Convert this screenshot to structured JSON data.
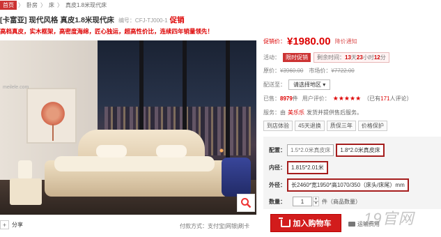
{
  "breadcrumb": [
    "首页",
    "卧房",
    "床",
    "真皮1.8米现代床"
  ],
  "breadcrumb_sep": "〉",
  "title": {
    "name": "[卡富亚] 现代风格 真皮1.8米现代床",
    "code": "编号：CFJ-TJ000-1",
    "hot": "促销"
  },
  "slogan": "高档真皮，实木框架，高密度海绵，匠心独运，超高性价比，连续四年销量领先！",
  "image": {
    "watermark": "meilele.com",
    "zoom_icon": "magnifier-icon"
  },
  "share": {
    "plus": "+",
    "label": "分享"
  },
  "payment": "付款方式：支付宝|网银|刷卡",
  "price": {
    "label": "促销价：",
    "value": "¥1980.00",
    "notify": "降价通知"
  },
  "promo": {
    "label": "活动：",
    "tag": "限时促销",
    "prefix": "剩余时间：",
    "days": "13",
    "days_unit": "天",
    "hours": "23",
    "hours_unit": "小时",
    "minutes": "12",
    "minutes_unit": "分"
  },
  "original": {
    "label": "原价：",
    "value": "¥3960.00",
    "market_label": "市场价：",
    "market_value": "¥7722.00"
  },
  "shipping": {
    "label": "配送至：",
    "select": "请选择地区",
    "arrow": "▾"
  },
  "sales": {
    "label": "已售：",
    "count": "8979",
    "unit": "件",
    "review_label": "用户评价：",
    "stars": "★★★★★",
    "review_pre": "（已有",
    "review_count": "171",
    "review_post": "人评论）"
  },
  "service": {
    "label": "服务：",
    "pre": "由",
    "store": "美乐乐",
    "post": "发货并提供售后服务。"
  },
  "tags": [
    "到店体验",
    "45天退换",
    "质保三年",
    "价格保护"
  ],
  "options": {
    "spec": {
      "label": "配置：",
      "values": [
        "1.5*2.0米真皮床",
        "1.8*2.0米真皮床"
      ]
    },
    "inner": {
      "label": "内径：",
      "value": "1.815*2.01米"
    },
    "outer": {
      "label": "外径：",
      "value": "长2460*宽1950*高1070/350（床头/床尾）mm"
    }
  },
  "quantity": {
    "label": "数量：",
    "value": "1",
    "unit": "件（商品数量）"
  },
  "cart_button": "加入购物车",
  "shipping_fee": "运输费用",
  "corner_watermark": "19官网"
}
